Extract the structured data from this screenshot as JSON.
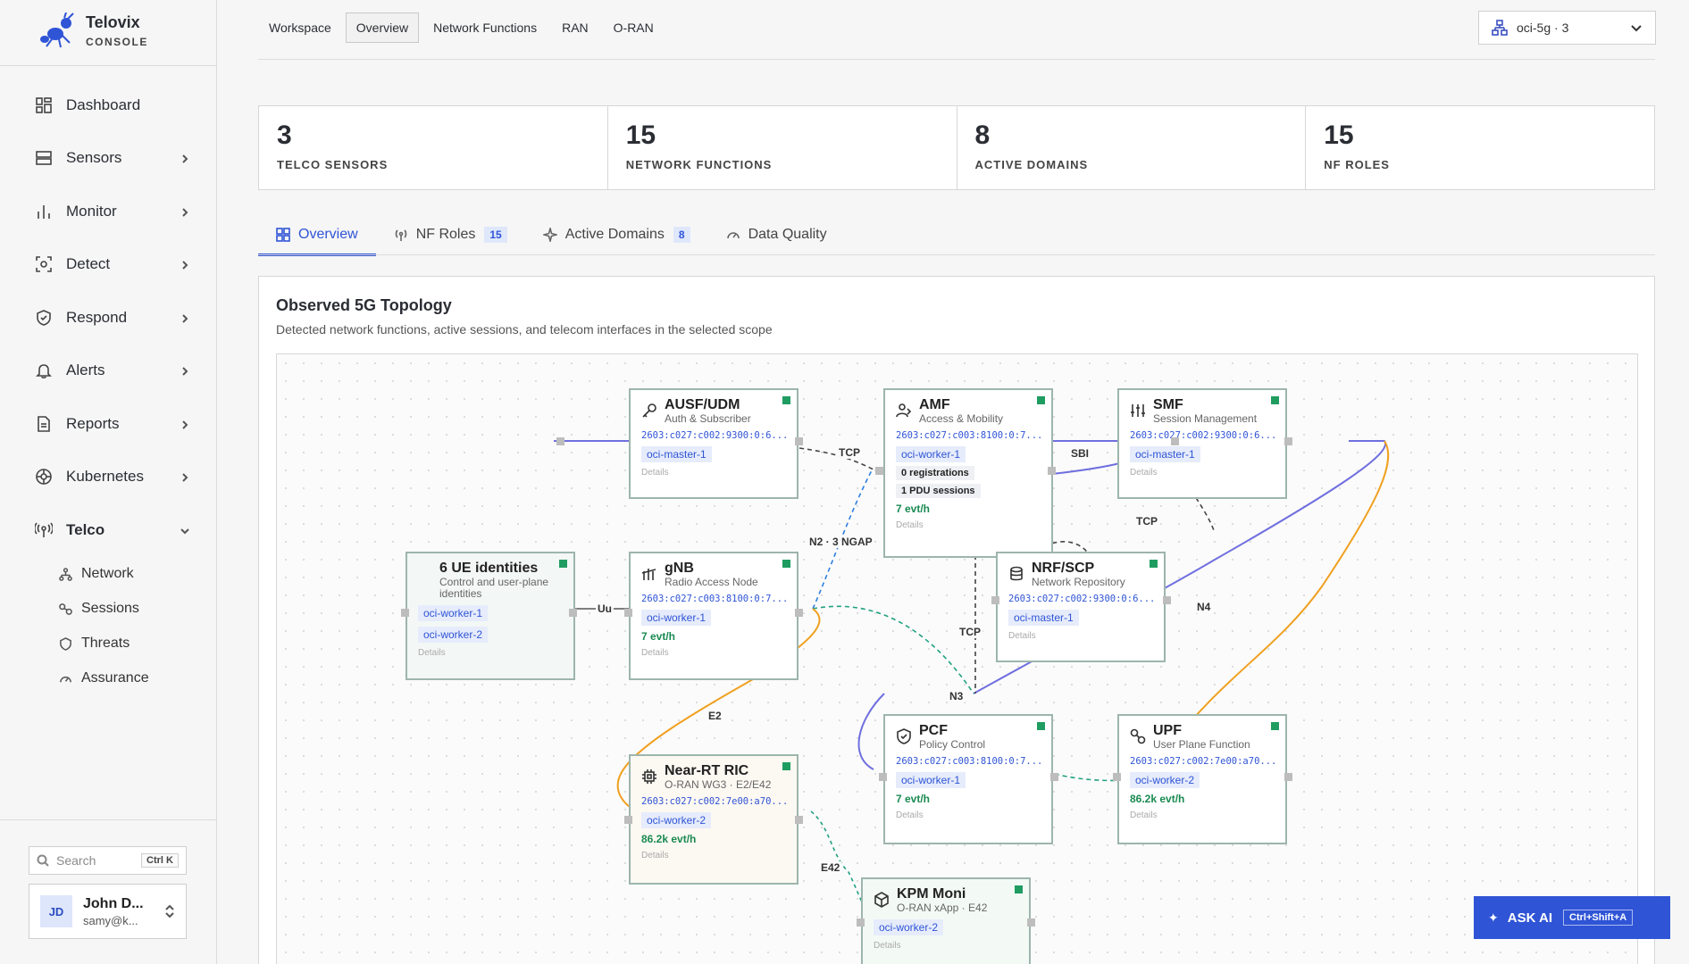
{
  "brand": {
    "name": "Telovix",
    "sub": "CONSOLE"
  },
  "nav": [
    {
      "label": "Dashboard"
    },
    {
      "label": "Sensors"
    },
    {
      "label": "Monitor"
    },
    {
      "label": "Detect"
    },
    {
      "label": "Respond"
    },
    {
      "label": "Alerts"
    },
    {
      "label": "Reports"
    },
    {
      "label": "Kubernetes"
    },
    {
      "label": "Telco"
    }
  ],
  "subnav": [
    "Network",
    "Sessions",
    "Threats",
    "Assurance"
  ],
  "search": {
    "placeholder": "Search",
    "shortcut": "Ctrl K"
  },
  "user": {
    "initials": "JD",
    "name": "John D...",
    "email": "samy@k..."
  },
  "toptabs": [
    "Workspace",
    "Overview",
    "Network Functions",
    "RAN",
    "O-RAN"
  ],
  "scope": {
    "value": "oci-5g · 3"
  },
  "stats": [
    {
      "value": "3",
      "label": "TELCO SENSORS"
    },
    {
      "value": "15",
      "label": "NETWORK FUNCTIONS"
    },
    {
      "value": "8",
      "label": "ACTIVE DOMAINS"
    },
    {
      "value": "15",
      "label": "NF ROLES"
    }
  ],
  "sectabs": [
    {
      "label": "Overview"
    },
    {
      "label": "NF Roles",
      "badge": "15"
    },
    {
      "label": "Active Domains",
      "badge": "8"
    },
    {
      "label": "Data Quality"
    }
  ],
  "panel": {
    "title": "Observed 5G Topology",
    "subtitle": "Detected network functions, active sessions, and telecom interfaces in the selected scope"
  },
  "nodes": {
    "ausf": {
      "name": "AUSF/UDM",
      "desc": "Auth & Subscriber",
      "ip": "2603:c027:c002:9300:0:6...",
      "host": "oci-master-1",
      "details": "Details"
    },
    "amf": {
      "name": "AMF",
      "desc": "Access & Mobility",
      "ip": "2603:c027:c003:8100:0:7...",
      "host": "oci-worker-1",
      "chip1": "0 registrations",
      "chip2": "1 PDU sessions",
      "evt": "7 evt/h",
      "details": "Details"
    },
    "smf": {
      "name": "SMF",
      "desc": "Session Management",
      "ip": "2603:c027:c002:9300:0:6...",
      "host": "oci-master-1",
      "details": "Details"
    },
    "ue": {
      "name": "6 UE identities",
      "desc": "Control and user-plane identities",
      "host1": "oci-worker-1",
      "host2": "oci-worker-2",
      "details": "Details"
    },
    "gnb": {
      "name": "gNB",
      "desc": "Radio Access Node",
      "ip": "2603:c027:c003:8100:0:7...",
      "host": "oci-worker-1",
      "evt": "7 evt/h",
      "details": "Details"
    },
    "nrf": {
      "name": "NRF/SCP",
      "desc": "Network Repository",
      "ip": "2603:c027:c002:9300:0:6...",
      "host": "oci-master-1",
      "details": "Details"
    },
    "ric": {
      "name": "Near-RT RIC",
      "desc": "O-RAN WG3 · E2/E42",
      "ip": "2603:c027:c002:7e00:a70...",
      "host": "oci-worker-2",
      "evt": "86.2k evt/h",
      "details": "Details"
    },
    "pcf": {
      "name": "PCF",
      "desc": "Policy Control",
      "ip": "2603:c027:c003:8100:0:7...",
      "host": "oci-worker-1",
      "evt": "7 evt/h",
      "details": "Details"
    },
    "upf": {
      "name": "UPF",
      "desc": "User Plane Function",
      "ip": "2603:c027:c002:7e00:a70...",
      "host": "oci-worker-2",
      "evt": "86.2k evt/h",
      "details": "Details"
    },
    "kpm": {
      "name": "KPM Moni",
      "desc": "O-RAN xApp · E42",
      "host": "oci-worker-2",
      "details": "Details"
    }
  },
  "edge_labels": {
    "tcp1": "TCP",
    "sbi": "SBI",
    "tcp2": "TCP",
    "n2": "N2 · 3 NGAP",
    "uu": "Uu",
    "n4": "N4",
    "tcp3": "TCP",
    "n3": "N3",
    "e2": "E2",
    "e42": "E42"
  },
  "askai": {
    "label": "ASK AI",
    "shortcut": "Ctrl+Shift+A"
  }
}
